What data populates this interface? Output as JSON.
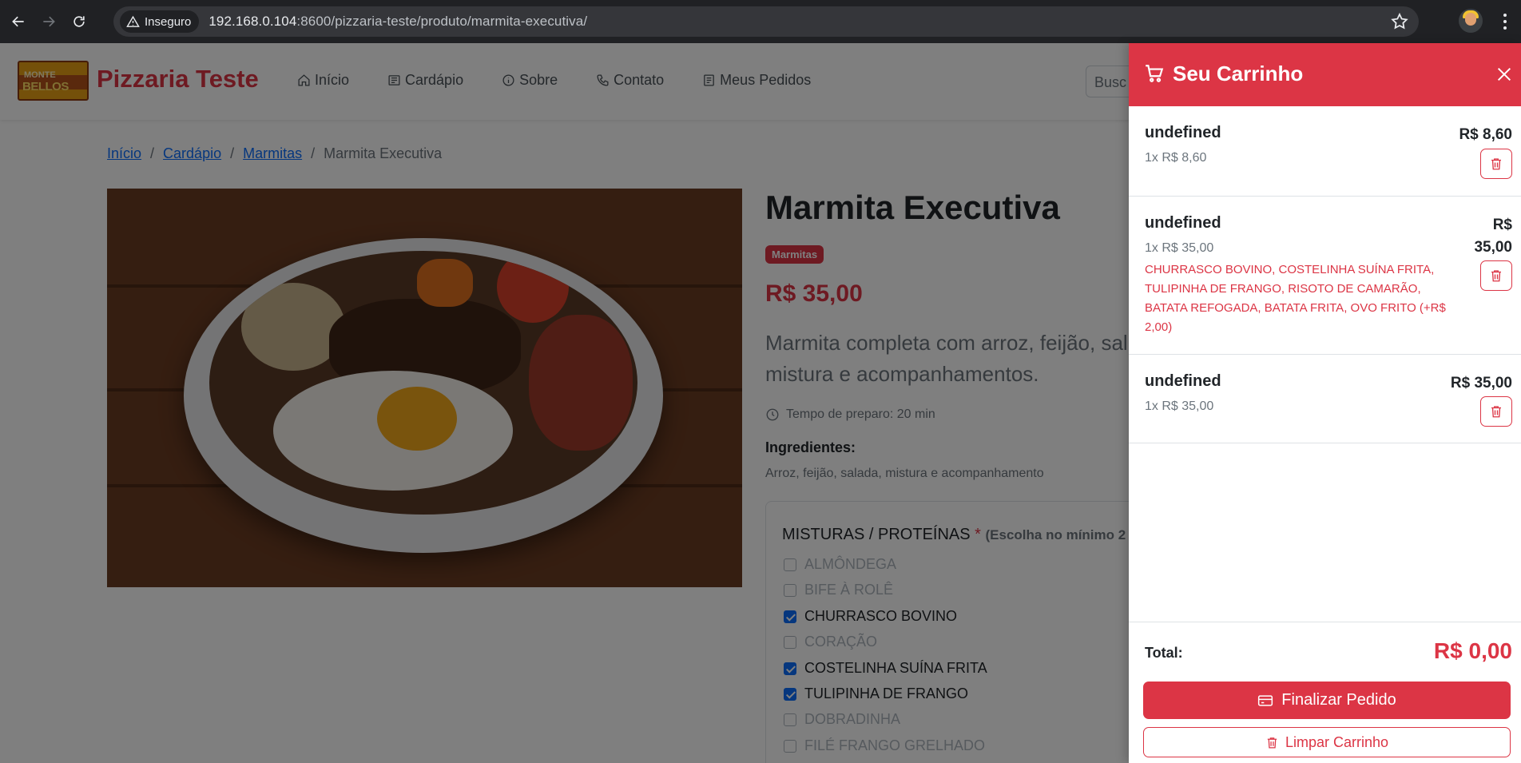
{
  "browser": {
    "security_label": "Inseguro",
    "url_host": "192.168.0.104",
    "url_rest": ":8600/pizzaria-teste/produto/marmita-executiva/"
  },
  "site": {
    "logo_line1": "MONTE",
    "logo_line2": "BELLOS",
    "brand_name": "Pizzaria Teste",
    "nav": [
      {
        "label": "Início",
        "icon": "home-icon"
      },
      {
        "label": "Cardápio",
        "icon": "menu-book-icon"
      },
      {
        "label": "Sobre",
        "icon": "info-icon"
      },
      {
        "label": "Contato",
        "icon": "phone-icon"
      },
      {
        "label": "Meus Pedidos",
        "icon": "receipt-icon"
      }
    ],
    "search_placeholder": "Busc"
  },
  "breadcrumb": {
    "home": "Início",
    "menu": "Cardápio",
    "category": "Marmitas",
    "current": "Marmita Executiva",
    "separator": "/"
  },
  "product": {
    "title": "Marmita Executiva",
    "category_badge": "Marmitas",
    "price": "R$ 35,00",
    "description": "Marmita completa com arroz, feijão, sal mistura e acompanhamentos.",
    "prep_time": "Tempo de preparo: 20 min",
    "ingredients_label": "Ingredientes:",
    "ingredients": "Arroz, feijão, salada, mistura e acompanhamento"
  },
  "options": {
    "title": "MISTURAS / PROTEÍNAS",
    "required_mark": "*",
    "hint": "(Escolha no mínimo 2",
    "items": [
      {
        "label": "ALMÔNDEGA",
        "checked": false
      },
      {
        "label": "BIFE À ROLÊ",
        "checked": false
      },
      {
        "label": "CHURRASCO BOVINO",
        "checked": true
      },
      {
        "label": "CORAÇÃO",
        "checked": false
      },
      {
        "label": "COSTELINHA SUÍNA FRITA",
        "checked": true
      },
      {
        "label": "TULIPINHA DE FRANGO",
        "checked": true
      },
      {
        "label": "DOBRADINHA",
        "checked": false
      },
      {
        "label": "FILÉ FRANGO GRELHADO",
        "checked": false
      }
    ]
  },
  "cart": {
    "title": "Seu Carrinho",
    "items": [
      {
        "name": "undefined",
        "qty": "1x R$ 8,60",
        "price": "R$ 8,60",
        "extras": ""
      },
      {
        "name": "undefined",
        "qty": "1x R$ 35,00",
        "price_line1": "R$",
        "price_line2": "35,00",
        "extras": "CHURRASCO BOVINO, COSTELINHA SUÍNA FRITA, TULIPINHA DE FRANGO, RISOTO DE CAMARÃO, BATATA REFOGADA, BATATA FRITA, OVO FRITO (+R$ 2,00)"
      },
      {
        "name": "undefined",
        "qty": "1x R$ 35,00",
        "price": "R$ 35,00",
        "extras": ""
      }
    ],
    "total_label": "Total:",
    "total_value": "R$ 0,00",
    "checkout_label": "Finalizar Pedido",
    "clear_label": "Limpar Carrinho"
  },
  "colors": {
    "brand_red": "#dc3545",
    "link_blue": "#0d6efd",
    "browser_dark": "#202124"
  }
}
